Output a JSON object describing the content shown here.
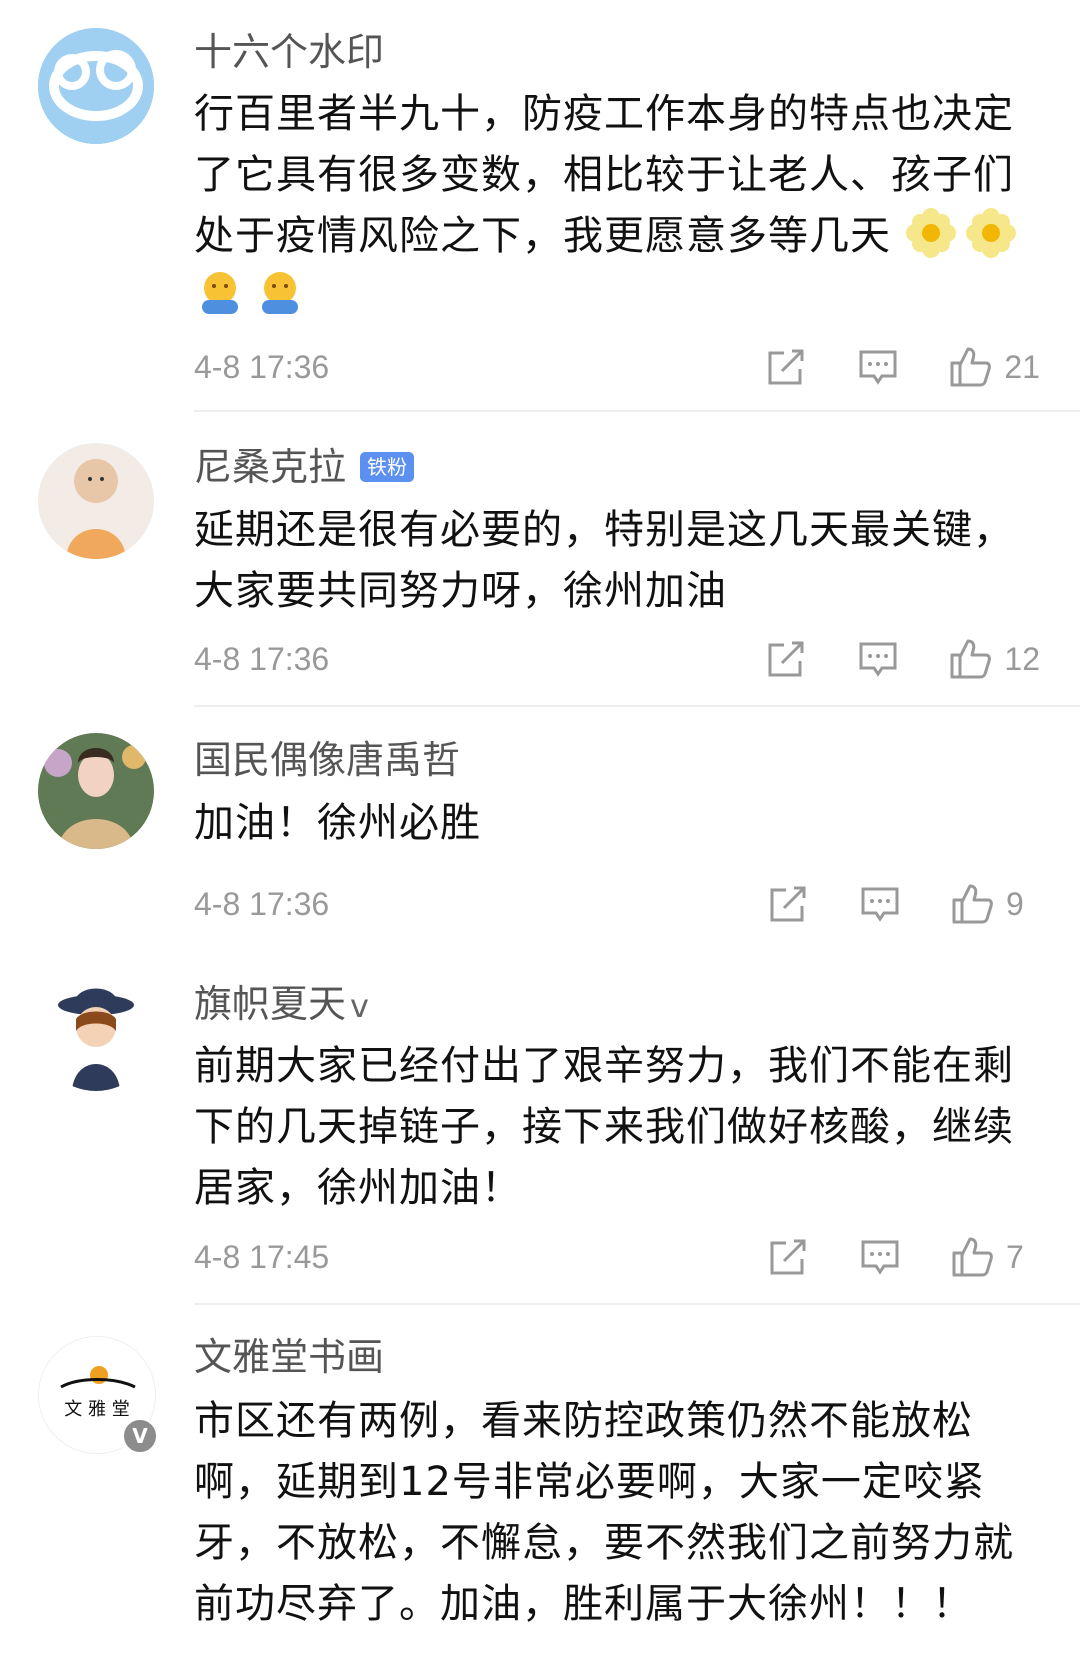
{
  "comments": [
    {
      "username": "十六个水印",
      "text": "行百里者半九十，防疫工作本身的特点也决定了它具有很多变数，相比较于让老人、孩子们处于疫情风险之下，我更愿意多等几天",
      "emojis": [
        "flower-emoji",
        "flower-emoji",
        "hug-emoji",
        "hug-emoji"
      ],
      "time": "4-8 17:36",
      "likes": "21"
    },
    {
      "username": "尼桑克拉",
      "badge": "铁粉",
      "text": "延期还是很有必要的，特别是这几天最关键，大家要共同努力呀，徐州加油",
      "time": "4-8 17:36",
      "likes": "12"
    },
    {
      "username": "国民偶像唐禹哲",
      "text": "加油！徐州必胜",
      "time": "4-8 17:36",
      "likes": "9"
    },
    {
      "username": "旗帜夏天",
      "verified_mark": "v",
      "text": "前期大家已经付出了艰辛努力，我们不能在剩下的几天掉链子，接下来我们做好核酸，继续居家，徐州加油！",
      "time": "4-8 17:45",
      "likes": "7"
    },
    {
      "username": "文雅堂书画",
      "avatar_text": "文 雅 堂",
      "verified_badge": "V",
      "text": "市区还有两例，看来防控政策仍然不能放松啊，延期到12号非常必要啊，大家一定咬紧牙，不放松，不懈怠，要不然我们之前努力就前功尽弃了。加油，胜利属于大徐州！！！"
    }
  ],
  "colors": {
    "username": "#555555",
    "text": "#111111",
    "meta": "#999999",
    "fan_badge": "#5b8ff0",
    "divider": "#eeeeee"
  }
}
